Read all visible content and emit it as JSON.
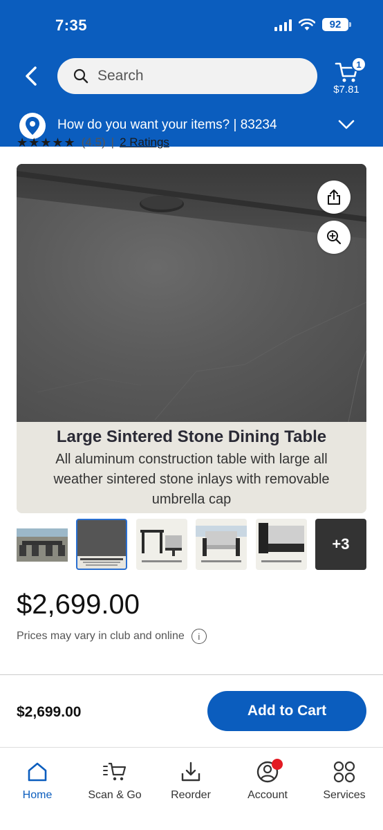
{
  "status_bar": {
    "time": "7:35",
    "battery": "92"
  },
  "header": {
    "search_placeholder": "Search",
    "cart_count": "1",
    "cart_total": "$7.81",
    "fulfillment_text": "How do you want your items?  | 83234"
  },
  "product": {
    "ratings_count": "(4.5)",
    "ratings_link": "2 Ratings",
    "image_title": "Large Sintered Stone Dining Table",
    "image_description": "All aluminum construction table with large all weather sintered stone inlays with removable umbrella cap",
    "more_thumbs": "+3",
    "price": "$2,699.00",
    "price_note": "Prices may vary in club and online"
  },
  "cart_bar": {
    "price": "$2,699.00",
    "add_label": "Add to Cart"
  },
  "tabs": [
    {
      "label": "Home",
      "icon": "home-icon"
    },
    {
      "label": "Scan & Go",
      "icon": "scan-cart-icon"
    },
    {
      "label": "Reorder",
      "icon": "reorder-icon"
    },
    {
      "label": "Account",
      "icon": "account-icon"
    },
    {
      "label": "Services",
      "icon": "services-icon"
    }
  ],
  "colors": {
    "brand": "#0b5dbe",
    "badge_red": "#e31b23"
  }
}
